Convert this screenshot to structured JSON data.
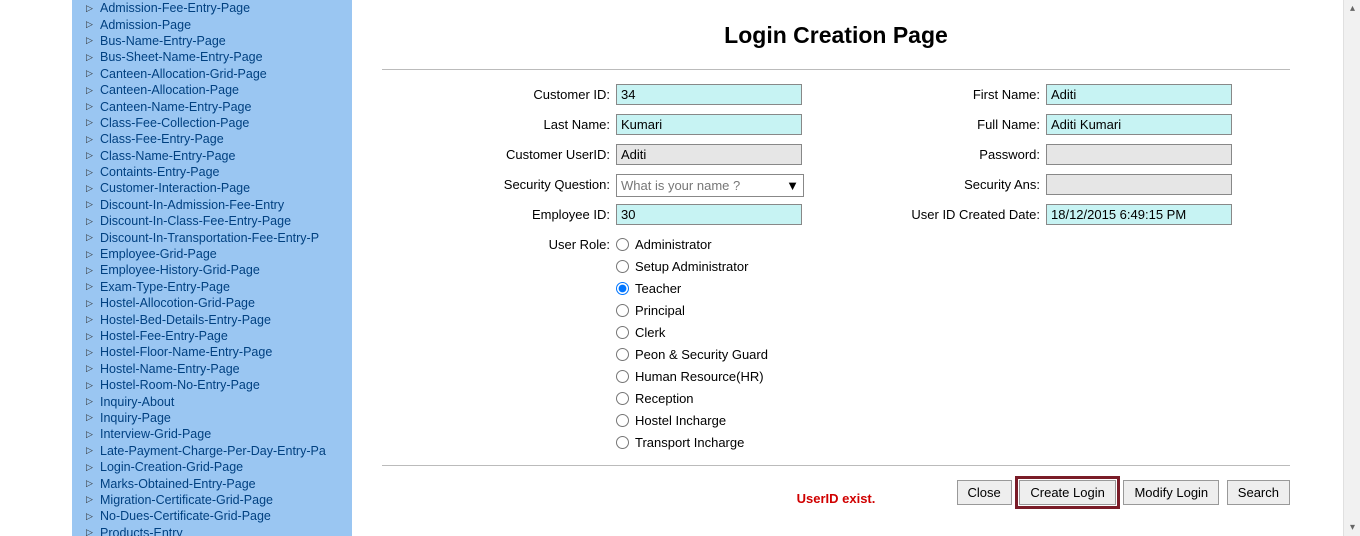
{
  "sidebar": {
    "items": [
      "Admission-Fee-Entry-Page",
      "Admission-Page",
      "Bus-Name-Entry-Page",
      "Bus-Sheet-Name-Entry-Page",
      "Canteen-Allocation-Grid-Page",
      "Canteen-Allocation-Page",
      "Canteen-Name-Entry-Page",
      "Class-Fee-Collection-Page",
      "Class-Fee-Entry-Page",
      "Class-Name-Entry-Page",
      "Containts-Entry-Page",
      "Customer-Interaction-Page",
      "Discount-In-Admission-Fee-Entry",
      "Discount-In-Class-Fee-Entry-Page",
      "Discount-In-Transportation-Fee-Entry-P",
      "Employee-Grid-Page",
      "Employee-History-Grid-Page",
      "Exam-Type-Entry-Page",
      "Hostel-Allocotion-Grid-Page",
      "Hostel-Bed-Details-Entry-Page",
      "Hostel-Fee-Entry-Page",
      "Hostel-Floor-Name-Entry-Page",
      "Hostel-Name-Entry-Page",
      "Hostel-Room-No-Entry-Page",
      "Inquiry-About",
      "Inquiry-Page",
      "Interview-Grid-Page",
      "Late-Payment-Charge-Per-Day-Entry-Pa",
      "Login-Creation-Grid-Page",
      "Marks-Obtained-Entry-Page",
      "Migration-Certificate-Grid-Page",
      "No-Dues-Certificate-Grid-Page",
      "Products-Entry"
    ]
  },
  "page": {
    "title": "Login Creation Page"
  },
  "form": {
    "customer_id": {
      "label": "Customer ID:",
      "value": "34"
    },
    "first_name": {
      "label": "First Name:",
      "value": "Aditi"
    },
    "last_name": {
      "label": "Last Name:",
      "value": "Kumari"
    },
    "full_name": {
      "label": "Full Name:",
      "value": "Aditi Kumari"
    },
    "customer_userid": {
      "label": "Customer UserID:",
      "value": "Aditi"
    },
    "password": {
      "label": "Password:",
      "value": ""
    },
    "security_question": {
      "label": "Security Question:",
      "selected": "What is your name ?"
    },
    "security_ans": {
      "label": "Security Ans:",
      "value": ""
    },
    "employee_id": {
      "label": "Employee ID:",
      "value": "30"
    },
    "user_created_date": {
      "label": "User ID Created Date:",
      "value": "18/12/2015 6:49:15 PM"
    },
    "user_role": {
      "label": "User Role:",
      "options": [
        "Administrator",
        "Setup Administrator",
        "Teacher",
        "Principal",
        "Clerk",
        "Peon & Security Guard",
        "Human Resource(HR)",
        "Reception",
        "Hostel Incharge",
        "Transport Incharge"
      ],
      "selected_index": 2
    }
  },
  "buttons": {
    "close": "Close",
    "create": "Create Login",
    "modify": "Modify Login",
    "search": "Search"
  },
  "status": "UserID exist."
}
